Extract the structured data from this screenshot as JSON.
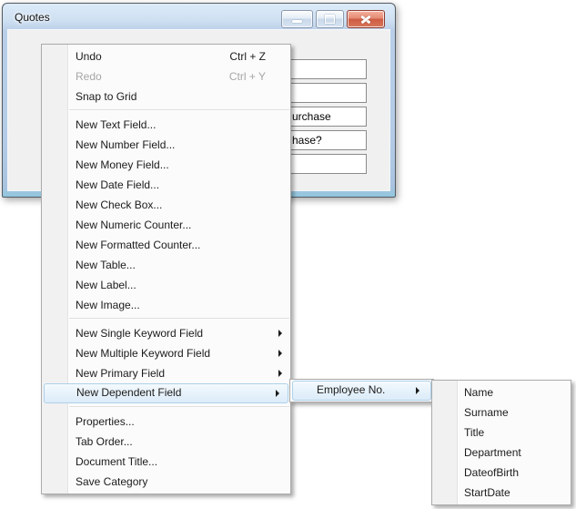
{
  "window": {
    "title": "Quotes",
    "fields": [
      {
        "value": ""
      },
      {
        "value": ""
      },
      {
        "value": "urchase"
      },
      {
        "value": "hase?"
      },
      {
        "value": ""
      }
    ]
  },
  "colors": {
    "titlebar_glass": "#c6d9ec",
    "client_background": "#f0f0f0",
    "menu_background": "#fbfbfb",
    "menu_highlight": "#dcecf9",
    "menu_highlight_border": "#aed1ea",
    "close_button_red": "#cd5c43",
    "disabled_text": "#a6a6a6"
  },
  "context_menu": {
    "items": [
      {
        "type": "item",
        "label": "Undo",
        "shortcut": "Ctrl + Z"
      },
      {
        "type": "item",
        "label": "Redo",
        "shortcut": "Ctrl + Y",
        "disabled": true
      },
      {
        "type": "item",
        "label": "Snap to Grid"
      },
      {
        "type": "separator"
      },
      {
        "type": "item",
        "label": "New Text Field..."
      },
      {
        "type": "item",
        "label": "New Number Field..."
      },
      {
        "type": "item",
        "label": "New Money Field..."
      },
      {
        "type": "item",
        "label": "New Date Field..."
      },
      {
        "type": "item",
        "label": "New Check Box..."
      },
      {
        "type": "item",
        "label": "New Numeric Counter..."
      },
      {
        "type": "item",
        "label": "New Formatted Counter..."
      },
      {
        "type": "item",
        "label": "New Table..."
      },
      {
        "type": "item",
        "label": "New Label..."
      },
      {
        "type": "item",
        "label": "New Image..."
      },
      {
        "type": "separator"
      },
      {
        "type": "item",
        "label": "New Single Keyword Field",
        "submenu": true
      },
      {
        "type": "item",
        "label": "New Multiple Keyword Field",
        "submenu": true
      },
      {
        "type": "item",
        "label": "New Primary Field",
        "submenu": true
      },
      {
        "type": "item",
        "label": "New Dependent Field",
        "submenu": true,
        "highlighted": true
      },
      {
        "type": "separator"
      },
      {
        "type": "item",
        "label": "Properties..."
      },
      {
        "type": "item",
        "label": "Tab Order..."
      },
      {
        "type": "item",
        "label": "Document Title..."
      },
      {
        "type": "item",
        "label": "Save Category"
      }
    ]
  },
  "dependent_submenu": {
    "items": [
      {
        "label": "Employee No.",
        "submenu": true,
        "highlighted": true
      }
    ]
  },
  "employee_submenu": {
    "items": [
      {
        "label": "Name"
      },
      {
        "label": "Surname"
      },
      {
        "label": "Title"
      },
      {
        "label": "Department"
      },
      {
        "label": "DateofBirth"
      },
      {
        "label": "StartDate"
      }
    ]
  }
}
